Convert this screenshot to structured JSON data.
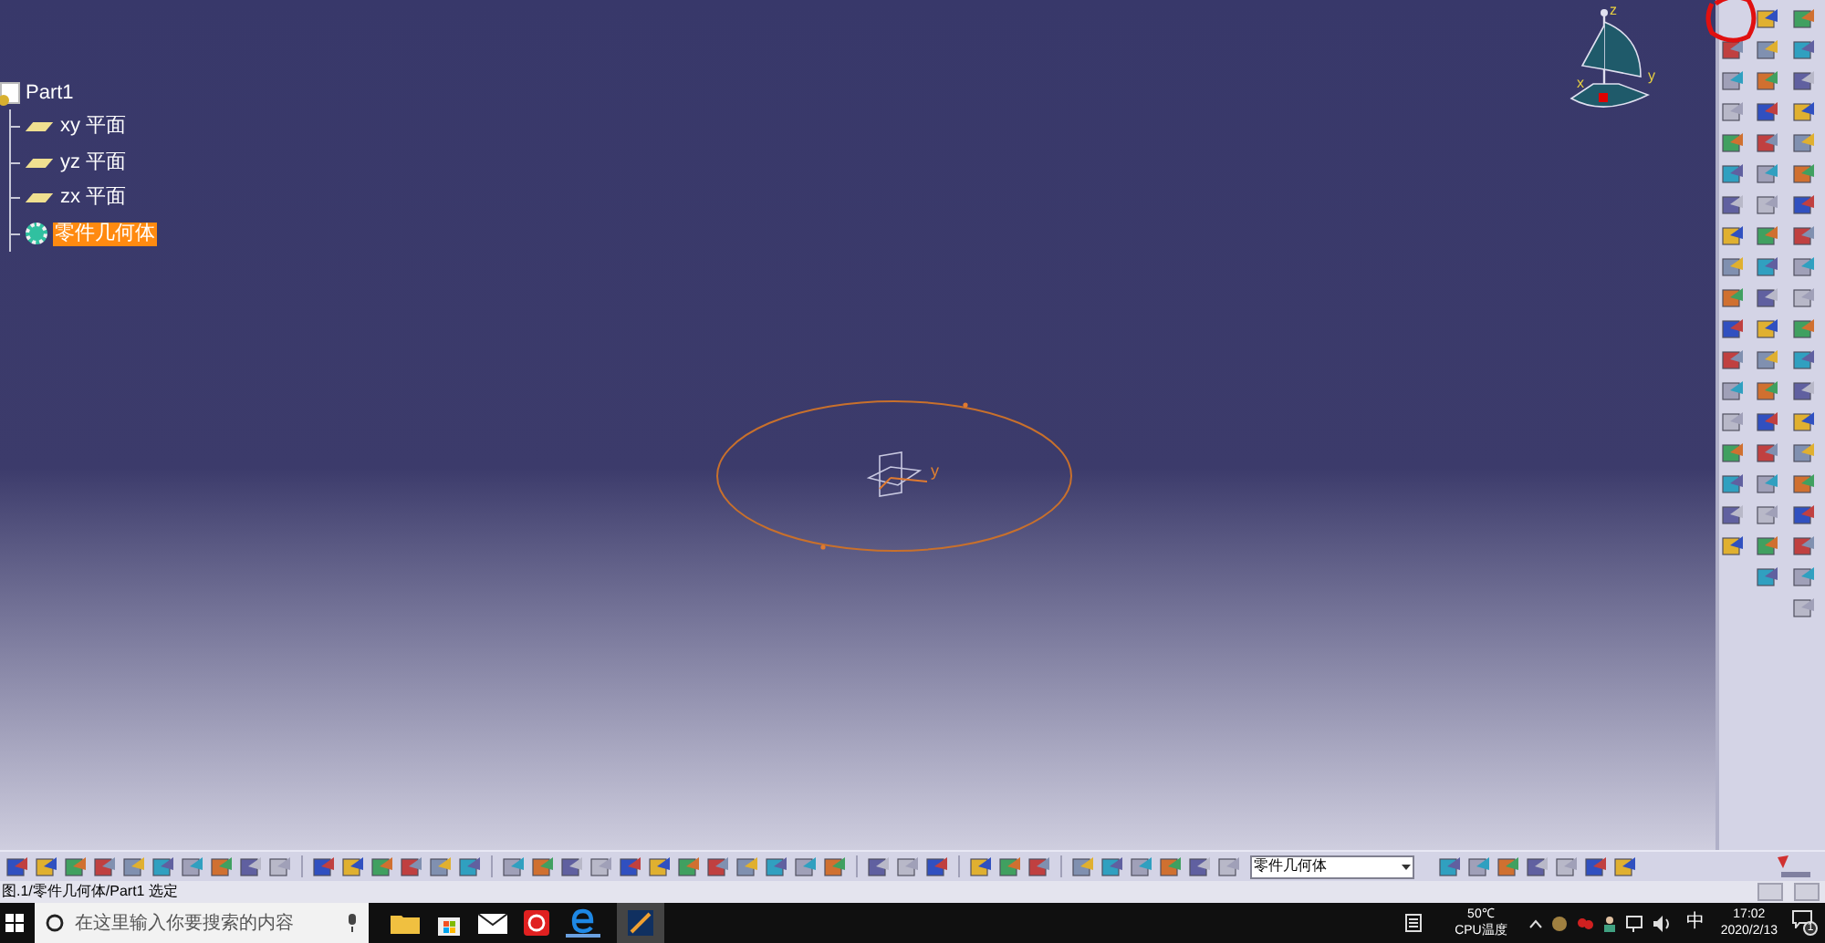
{
  "tree": {
    "label": "Part1",
    "children": [
      {
        "label": "xy 平面",
        "kind": "plane",
        "selected": false
      },
      {
        "label": "yz 平面",
        "kind": "plane",
        "selected": false
      },
      {
        "label": "zx 平面",
        "kind": "plane",
        "selected": false
      },
      {
        "label": "零件几何体",
        "kind": "body",
        "selected": true
      }
    ]
  },
  "compass": {
    "axes": [
      "z",
      "y",
      "x"
    ]
  },
  "sketch_axis_label": "y",
  "body_dropdown": {
    "value": "零件几何体"
  },
  "status_bar": {
    "text": "图.1/零件几何体/Part1 选定"
  },
  "taskbar": {
    "search_placeholder": "在这里输入你要搜索的内容",
    "cpu_temp": "50℃",
    "cpu_label": "CPU温度",
    "ime": "中",
    "time": "17:02",
    "date": "2020/2/13",
    "notifications": "1"
  }
}
